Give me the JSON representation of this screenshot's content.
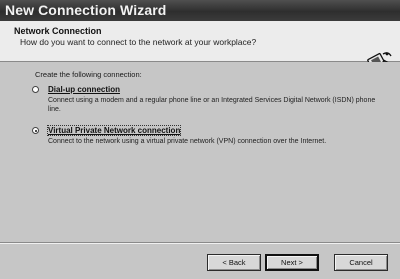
{
  "window": {
    "title": "New Connection Wizard"
  },
  "header": {
    "title": "Network Connection",
    "subtitle": "How do you want to connect to the network at your workplace?",
    "icon": "network-wizard-icon"
  },
  "content": {
    "instruction": "Create the following connection:",
    "options": [
      {
        "label": "Dial-up connection",
        "description": "Connect using a modem and a regular phone line or an Integrated Services Digital Network (ISDN) phone line.",
        "selected": false
      },
      {
        "label": "Virtual Private Network connection",
        "description": "Connect to the network using a virtual private network (VPN) connection over the Internet.",
        "selected": true
      }
    ]
  },
  "buttons": {
    "back": "< Back",
    "next": "Next >",
    "cancel": "Cancel"
  }
}
